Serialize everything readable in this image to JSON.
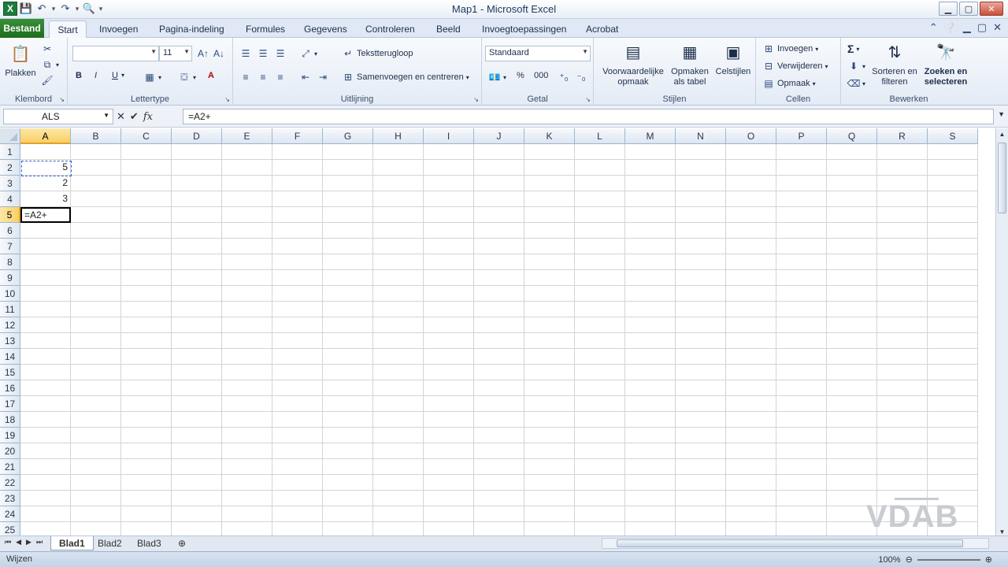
{
  "window": {
    "title": "Map1 - Microsoft Excel"
  },
  "tabs": [
    "Bestand",
    "Start",
    "Invoegen",
    "Pagina-indeling",
    "Formules",
    "Gegevens",
    "Controleren",
    "Beeld",
    "Invoegtoepassingen",
    "Acrobat"
  ],
  "ribbon": {
    "clipboard": {
      "paste": "Plakken",
      "label": "Klembord"
    },
    "font": {
      "font_name": "",
      "font_size": "11",
      "label": "Lettertype",
      "bold": "B",
      "italic": "I",
      "underline": "U",
      "font_color": "A"
    },
    "alignment": {
      "wrap": "Tekstterugloop",
      "merge": "Samenvoegen en centreren",
      "label": "Uitlijning"
    },
    "number": {
      "format": "Standaard",
      "label": "Getal",
      "percent": "%",
      "thousands": "000"
    },
    "styles": {
      "conditional": "Voorwaardelijke\nopmaak",
      "as_table": "Opmaken\nals tabel",
      "cell_styles": "Celstijlen",
      "label": "Stijlen"
    },
    "cells": {
      "insert": "Invoegen",
      "delete": "Verwijderen",
      "format": "Opmaak",
      "label": "Cellen"
    },
    "editing": {
      "sort": "Sorteren en\nfilteren",
      "find": "Zoeken en\nselecteren",
      "label": "Bewerken",
      "sigma": "Σ"
    }
  },
  "formula_bar": {
    "name_box": "ALS",
    "formula": "=A2+",
    "fx": "fx"
  },
  "columns": [
    "A",
    "B",
    "C",
    "D",
    "E",
    "F",
    "G",
    "H",
    "I",
    "J",
    "K",
    "L",
    "M",
    "N",
    "O",
    "P",
    "Q",
    "R",
    "S"
  ],
  "rows": [
    "1",
    "2",
    "3",
    "4",
    "5",
    "6",
    "7",
    "8",
    "9",
    "10",
    "11",
    "12",
    "13",
    "14",
    "15",
    "16",
    "17",
    "18",
    "19",
    "20",
    "21",
    "22",
    "23",
    "24",
    "25"
  ],
  "cells": {
    "A2": "5",
    "A3": "2",
    "A4": "3",
    "A5": "=A2+"
  },
  "active_cell": "A5",
  "sheets": [
    "Blad1",
    "Blad2",
    "Blad3"
  ],
  "status": {
    "mode": "Wijzen",
    "zoom": "100%"
  },
  "watermark": "VDAB",
  "colors": {
    "file_tab": "#2a7f2a",
    "selection_header": "#f9cf66",
    "ref_border": "#2d5fd0"
  }
}
